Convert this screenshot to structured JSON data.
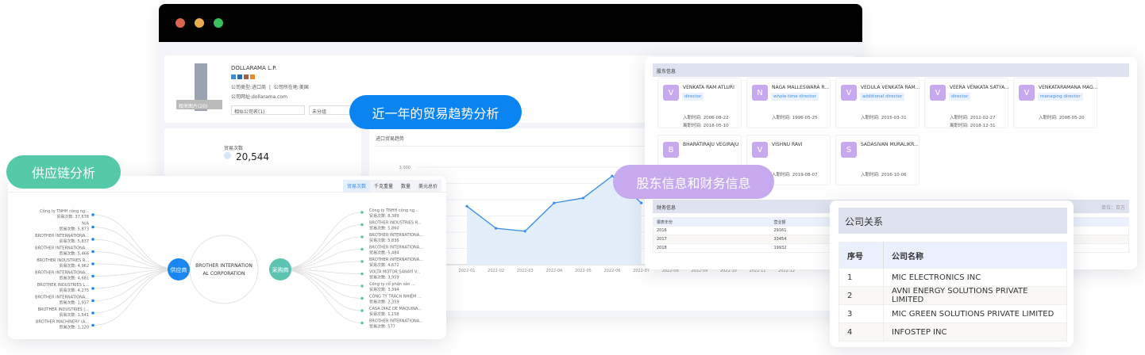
{
  "window": {
    "dots": [
      "#d9654f",
      "#e8ad4f",
      "#36c05d"
    ]
  },
  "company": {
    "name": "DOLLARAMA L.P.",
    "image_label": "相关图片(20)",
    "social_icons": [
      "twitter-icon",
      "linkedin-icon",
      "instagram-icon",
      "phone-icon"
    ],
    "type_label": "公司类型:",
    "type_value": "进口商",
    "location_label": "公司所在地:",
    "location_value": "美国",
    "website_label": "公司网址:",
    "website_value": "dollarama.com",
    "select1": "相似公司名(1)",
    "select2": "未分组"
  },
  "stats": {
    "label": "贸易次数",
    "value": "20,544"
  },
  "pills": {
    "trend": "近一年的贸易趋势分析",
    "supply": "供应链分析",
    "shareholder": "股东信息和财务信息"
  },
  "chart_data": {
    "type": "area",
    "title": "进口贸易趋势",
    "categories": [
      "2022-01",
      "2022-02",
      "2022-03",
      "2022-04",
      "2022-05",
      "2022-06",
      "2022-07",
      "2022-08",
      "2022-09",
      "2022-10",
      "2022-11",
      "2022-12"
    ],
    "values": [
      1800,
      1120,
      1030,
      1900,
      2050,
      2730,
      1900,
      null,
      null,
      null,
      null,
      null
    ],
    "ylim": [
      0,
      3000
    ],
    "yticks": [
      "3,000"
    ],
    "color": "#3a8ee6",
    "grid": true
  },
  "supply_chain": {
    "tabs": [
      "贸易次数",
      "千克重量",
      "数量",
      "美元总价"
    ],
    "active_tab": 0,
    "center": [
      "BROTHER INTERNATION",
      "AL CORPORATION"
    ],
    "supplier_label": "供应商",
    "buyer_label": "采购商",
    "count_prefix": "贸易次数: ",
    "suppliers": [
      {
        "name": "Công ty TNHH công ng...",
        "count": "37,678"
      },
      {
        "name": "N/A",
        "count": "5,873"
      },
      {
        "name": "BROTHER INTERNATIONA...",
        "count": "5,837"
      },
      {
        "name": "BROTHER INTERNATIONA...",
        "count": "5,466"
      },
      {
        "name": "BROTHER INDUSTRIES R...",
        "count": "4,962"
      },
      {
        "name": "BROTHER INTERNATIONA...",
        "count": "4,681"
      },
      {
        "name": "BROTHER INDUSTRIES L...",
        "count": "4,275"
      },
      {
        "name": "BROTHER INTERNATIONA...",
        "count": "1,937"
      },
      {
        "name": "BROTHER INDUSTRIES (...",
        "count": "1,541"
      },
      {
        "name": "BROTHER MACHINERY (A...",
        "count": "1,120"
      }
    ],
    "buyers": [
      {
        "name": "Công ty TNHH công ng...",
        "count": "8,389"
      },
      {
        "name": "BROTHER INDUSTRIES R...",
        "count": "5,860"
      },
      {
        "name": "BROTHER INTERNATIONA...",
        "count": "5,836"
      },
      {
        "name": "BROTHER INTERNATIONA...",
        "count": "5,484"
      },
      {
        "name": "BROTHER INTERNATIONA...",
        "count": "4,672"
      },
      {
        "name": "VOLTA MOTOR SANAYİ V...",
        "count": "3,959"
      },
      {
        "name": "Công ty cổ phần sản ...",
        "count": "3,394"
      },
      {
        "name": "CÔNG TY TRÁCH NHIỆM ...",
        "count": "2,359"
      },
      {
        "name": "CASA DIAZ DE MAQUINA...",
        "count": "1,158"
      },
      {
        "name": "BROTHER INTERNATIONA...",
        "count": "577"
      }
    ],
    "supplier_color": "#1a86f0",
    "buyer_color": "#5cc4b0"
  },
  "shareholders": {
    "title": "股东信息",
    "join_label": "入职时间: ",
    "leave_label": "离职时间: ",
    "items": [
      {
        "initial": "V",
        "name": "VENKATA RAM ATLURI",
        "role": "director",
        "join": "2006-08-22",
        "leave": "2018-05-10"
      },
      {
        "initial": "N",
        "name": "NAGA MALLESWARA R...",
        "role": "whole-time director",
        "join": "1996-05-25"
      },
      {
        "initial": "V",
        "name": "VEDULA VENKATA RAM...",
        "role": "additional director",
        "join": "2015-03-31"
      },
      {
        "initial": "V",
        "name": "VEERA VENKATA SATYA...",
        "role": "director",
        "join": "2012-02-27",
        "leave": "2018-12-31"
      },
      {
        "initial": "V",
        "name": "VENKATARAMANA MAG...",
        "role": "managing director",
        "join": "2008-05-20"
      },
      {
        "initial": "B",
        "name": "BHARATIRAJU VEGIRAJU"
      },
      {
        "initial": "V",
        "name": "VISHNU RAVI",
        "join": "2019-08-07"
      },
      {
        "initial": "S",
        "name": "SADASIVAN MURALIKR...",
        "join": "2016-10-06"
      }
    ]
  },
  "finance": {
    "title": "财务信息",
    "unit": "单位：百万",
    "headers": [
      "报表年份",
      "营业额"
    ],
    "rows": [
      [
        "2016",
        "29161"
      ],
      [
        "2017",
        "33454"
      ],
      [
        "2018",
        "19932"
      ]
    ]
  },
  "relations": {
    "title": "公司关系",
    "headers": [
      "序号",
      "公司名称"
    ],
    "rows": [
      [
        "1",
        "MIC ELECTRONICS INC"
      ],
      [
        "2",
        "AVNI ENERGY SOLUTIONS PRIVATE LIMITED"
      ],
      [
        "3",
        "MIC GREEN SOLUTIONS PRIVATE LIMITED"
      ],
      [
        "4",
        "INFOSTEP INC"
      ]
    ]
  }
}
